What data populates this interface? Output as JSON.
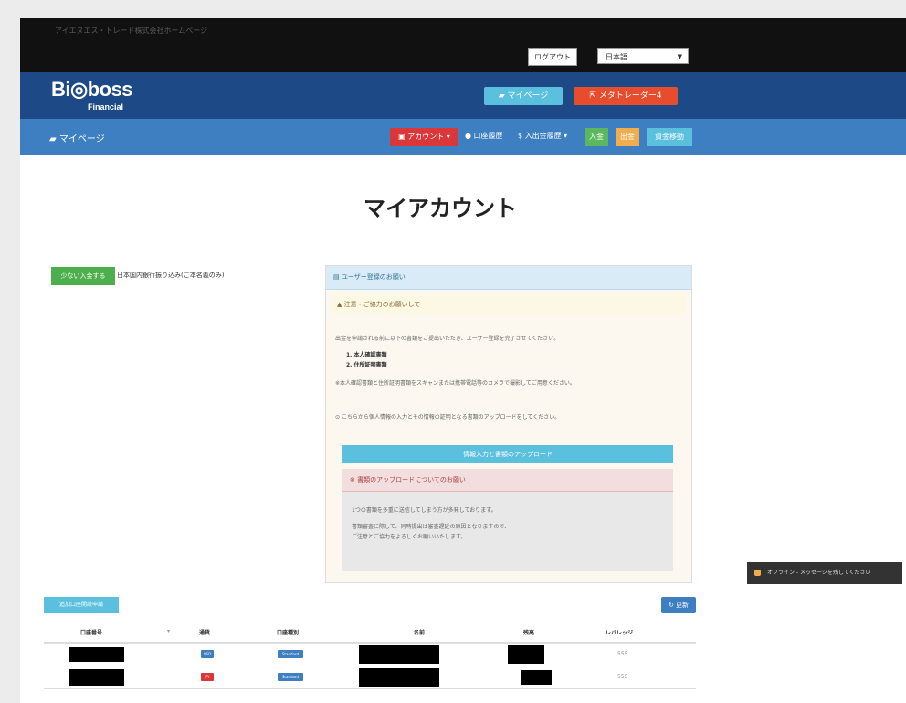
{
  "topbar": {
    "notice": "アイエヌエス・トレード株式会社ホームページ",
    "logout_label": "ログアウト",
    "language_value": "日本語"
  },
  "brand": {
    "logo_main": "Bi◎boss",
    "logo_sub": "Financial",
    "mypage_button": "マイページ",
    "metatrader_button": "メタトレーダー4"
  },
  "nav": {
    "title": "マイページ",
    "account_label": "アカウント ▾",
    "link_accounts": "口座履歴",
    "link_funds": "入出金履歴 ▾",
    "deposit_label": "入金",
    "withdraw_label": "出金",
    "history_label": "資金移動"
  },
  "page": {
    "title": "マイアカウント"
  },
  "aside": {
    "green_button": "少ない入金する",
    "note": "日本国内銀行振り込み(ご本名義のみ)"
  },
  "panel": {
    "header": "ユーザー登録のお願い",
    "warning_title": "注意・ご協力のお願いして",
    "intro": "出金を申請される前に以下の書類をご提出いただき、ユーザー登録を完了させてください。",
    "item1": "1. 本人確認書類",
    "item2": "2. 住所証明書類",
    "note1": "※本人確認書類と住所証明書類をスキャンまたは携帯電話等のカメラで撮影してご用意ください。",
    "note2": "こちらから個人情報の入力とその情報の証明となる書類のアップロードをしてください。",
    "upload_button": "情報入力と書類のアップロード",
    "danger_title": "書類のアップロードについてのお願い",
    "danger_line1": "1つの書類を多重に送信してしまう方が多発しております。",
    "danger_line2": "書類審査に際して、同時提出は審査遅延の原因となりますので、",
    "danger_line3": "ご注意とご協力をよろしくお願いいたします。"
  },
  "chat": {
    "label": "オフライン - メッセージを残してください"
  },
  "table_section": {
    "apply_button": "追加口座開設申請",
    "refresh_button": "更新",
    "columns": [
      "口座番号",
      "通貨",
      "口座種別",
      "名前",
      "残高",
      "レバレッジ"
    ],
    "rows": [
      {
        "currency": "USD",
        "currency_color": "#3d7fc0",
        "type": "Standard",
        "leverage": "555"
      },
      {
        "currency": "JPY",
        "currency_color": "#d9373a",
        "type": "Standard",
        "leverage": "555"
      }
    ]
  }
}
